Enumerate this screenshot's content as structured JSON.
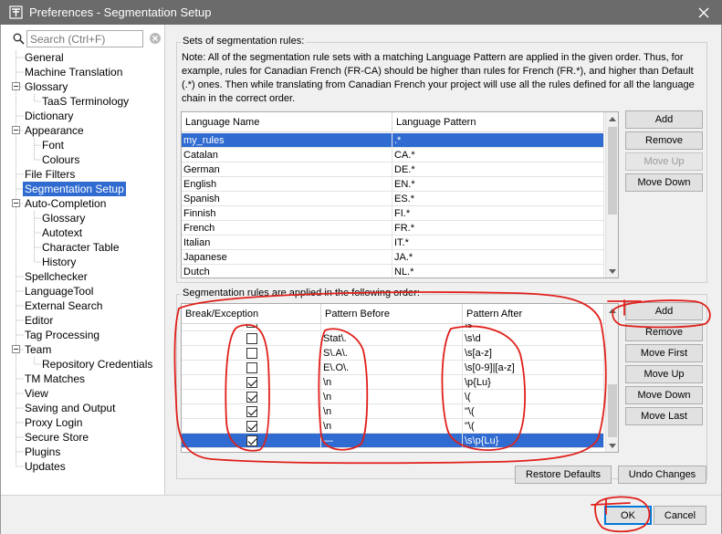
{
  "window": {
    "title": "Preferences - Segmentation Setup",
    "close_glyph": "✕"
  },
  "search": {
    "placeholder": "Search (Ctrl+F)"
  },
  "tree": [
    {
      "label": "General"
    },
    {
      "label": "Machine Translation"
    },
    {
      "label": "Glossary"
    },
    {
      "label": "TaaS Terminology"
    },
    {
      "label": "Dictionary"
    },
    {
      "label": "Appearance"
    },
    {
      "label": "Font"
    },
    {
      "label": "Colours"
    },
    {
      "label": "File Filters"
    },
    {
      "label": "Segmentation Setup"
    },
    {
      "label": "Auto-Completion"
    },
    {
      "label": "Glossary"
    },
    {
      "label": "Autotext"
    },
    {
      "label": "Character Table"
    },
    {
      "label": "History"
    },
    {
      "label": "Spellchecker"
    },
    {
      "label": "LanguageTool"
    },
    {
      "label": "External Search"
    },
    {
      "label": "Editor"
    },
    {
      "label": "Tag Processing"
    },
    {
      "label": "Team"
    },
    {
      "label": "Repository Credentials"
    },
    {
      "label": "TM Matches"
    },
    {
      "label": "View"
    },
    {
      "label": "Saving and Output"
    },
    {
      "label": "Proxy Login"
    },
    {
      "label": "Secure Store"
    },
    {
      "label": "Plugins"
    },
    {
      "label": "Updates"
    }
  ],
  "rulesets": {
    "title": "Sets of segmentation rules:",
    "note": "Note: All of the segmentation rule sets with a matching Language Pattern are applied in the given order. Thus, for example, rules for Canadian French (FR-CA) should be higher than rules for French (FR.*), and higher than Default (.*) ones. Then while translating from Canadian French your project will use all the rules defined for all the language chain in the correct order.",
    "columns": [
      "Language Name",
      "Language Pattern"
    ],
    "rows": [
      [
        "my_rules",
        ".*"
      ],
      [
        "Catalan",
        "CA.*"
      ],
      [
        "German",
        "DE.*"
      ],
      [
        "English",
        "EN.*"
      ],
      [
        "Spanish",
        "ES.*"
      ],
      [
        "Finnish",
        "FI.*"
      ],
      [
        "French",
        "FR.*"
      ],
      [
        "Italian",
        "IT.*"
      ],
      [
        "Japanese",
        "JA.*"
      ],
      [
        "Dutch",
        "NL.*"
      ]
    ],
    "buttons": {
      "add": "Add",
      "remove": "Remove",
      "move_up": "Move Up",
      "move_down": "Move Down"
    }
  },
  "rules": {
    "title": "Segmentation rules are applied in the following order:",
    "columns": [
      "Break/Exception",
      "Pattern Before",
      "Pattern After"
    ],
    "partial_row": [
      "",
      "",
      "\\s"
    ],
    "rows": [
      {
        "checked": false,
        "before": "Stat\\.",
        "after": "\\s\\d"
      },
      {
        "checked": false,
        "before": "S\\.A\\.",
        "after": "\\s[a-z]"
      },
      {
        "checked": false,
        "before": "E\\.O\\.",
        "after": "\\s[0-9]|[a-z]"
      },
      {
        "checked": true,
        "before": "\\n",
        "after": "\\p{Lu}"
      },
      {
        "checked": true,
        "before": "\\n",
        "after": "\\("
      },
      {
        "checked": true,
        "before": "\\n",
        "after": "\"\\("
      },
      {
        "checked": true,
        "before": "\\n",
        "after": "\"\\("
      },
      {
        "checked": true,
        "before": "—",
        "after": "\\s\\p{Lu}"
      }
    ],
    "buttons": {
      "add": "Add",
      "remove": "Remove",
      "move_first": "Move First",
      "move_up": "Move Up",
      "move_down": "Move Down",
      "move_last": "Move Last"
    }
  },
  "footer": {
    "restore_defaults": "Restore Defaults",
    "undo_changes": "Undo Changes",
    "ok": "OK",
    "cancel": "Cancel"
  },
  "colors": {
    "selection": "#2f6bd0",
    "annotation": "#e0201b",
    "titlebar": "#6b6b6b"
  }
}
